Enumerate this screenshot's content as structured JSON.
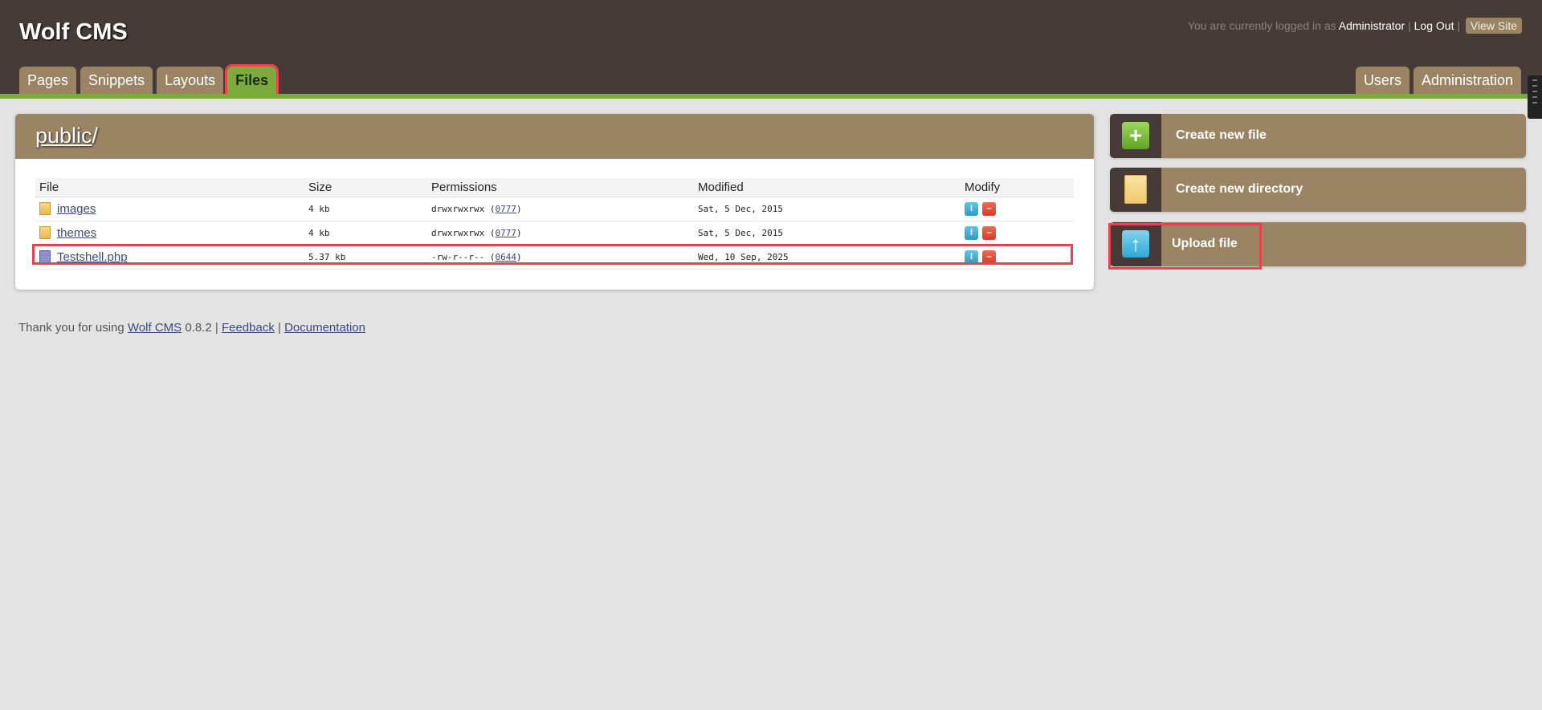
{
  "header": {
    "site_title": "Wolf CMS",
    "login_prefix": "You are currently logged in as",
    "user": "Administrator",
    "logout": "Log Out",
    "view_site": "View Site",
    "separator": "|"
  },
  "nav": {
    "left_tabs": [
      {
        "label": "Pages"
      },
      {
        "label": "Snippets"
      },
      {
        "label": "Layouts"
      },
      {
        "label": "Files",
        "active": true
      }
    ],
    "right_tabs": [
      {
        "label": "Users"
      },
      {
        "label": "Administration"
      }
    ]
  },
  "main": {
    "breadcrumb_dir": "public",
    "breadcrumb_sep": "/",
    "columns": [
      "File",
      "Size",
      "Permissions",
      "Modified",
      "Modify"
    ],
    "rows": [
      {
        "name": "images",
        "type": "folder",
        "size": "4 kb",
        "perm": "drwxrwxrwx",
        "octal": "0777",
        "modified": "Sat, 5 Dec, 2015"
      },
      {
        "name": "themes",
        "type": "folder",
        "size": "4 kb",
        "perm": "drwxrwxrwx",
        "octal": "0777",
        "modified": "Sat, 5 Dec, 2015"
      },
      {
        "name": "Testshell.php",
        "type": "php",
        "size": "5.37 kb",
        "perm": "-rw-r--r--",
        "octal": "0644",
        "modified": "Wed, 10 Sep, 2025"
      }
    ]
  },
  "sidebar": {
    "actions": [
      {
        "label": "Create new file",
        "icon": "plus-icon"
      },
      {
        "label": "Create new directory",
        "icon": "folder-icon"
      },
      {
        "label": "Upload file",
        "icon": "upload-arrow-icon"
      }
    ]
  },
  "footer": {
    "prefix": "Thank you for using",
    "product": "Wolf CMS",
    "version": "0.8.2",
    "sep": "|",
    "feedback": "Feedback",
    "documentation": "Documentation"
  },
  "colors": {
    "header_bg": "#463b36",
    "accent_tan": "#9b8463",
    "active_green": "#7aab3c",
    "highlight_red": "#e9434f"
  }
}
